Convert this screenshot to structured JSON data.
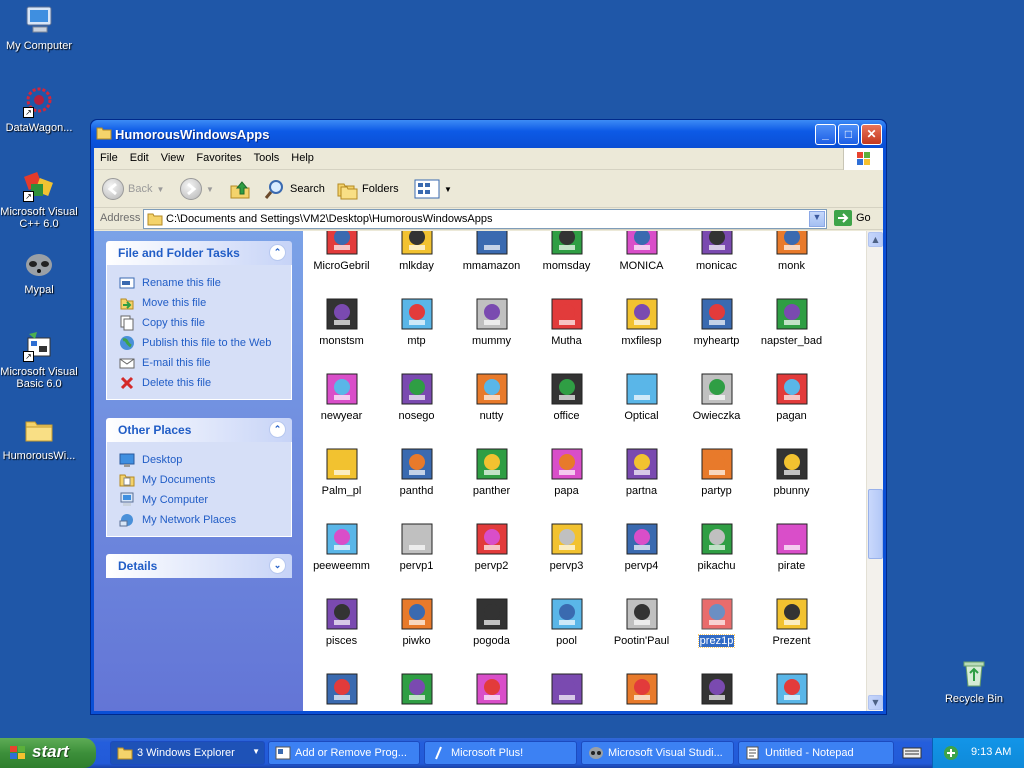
{
  "desktop": {
    "icons": [
      {
        "label": "My Computer",
        "icon": "computer-icon"
      },
      {
        "label": "DataWagon...",
        "icon": "datawagon-icon"
      },
      {
        "label": "Microsoft Visual C++ 6.0",
        "icon": "visual-cpp-icon"
      },
      {
        "label": "Mypal",
        "icon": "mypal-icon"
      },
      {
        "label": "Microsoft Visual Basic 6.0",
        "icon": "visual-basic-icon"
      },
      {
        "label": "HumorousWi...",
        "icon": "folder-icon"
      },
      {
        "label": "Recycle Bin",
        "icon": "recycle-bin-icon"
      }
    ]
  },
  "window": {
    "title": "HumorousWindowsApps",
    "menu": [
      "File",
      "Edit",
      "View",
      "Favorites",
      "Tools",
      "Help"
    ],
    "toolbar": {
      "back": "Back",
      "search": "Search",
      "folders": "Folders"
    },
    "address": {
      "label": "Address",
      "value": "C:\\Documents and Settings\\VM2\\Desktop\\HumorousWindowsApps",
      "go": "Go"
    }
  },
  "taskpane": {
    "file_tasks": {
      "title": "File and Folder Tasks",
      "items": [
        "Rename this file",
        "Move this file",
        "Copy this file",
        "Publish this file to the Web",
        "E-mail this file",
        "Delete this file"
      ]
    },
    "other_places": {
      "title": "Other Places",
      "items": [
        "Desktop",
        "My Documents",
        "My Computer",
        "My Network Places"
      ]
    },
    "details": {
      "title": "Details"
    }
  },
  "files": [
    [
      "MicroGebril",
      "mlkday",
      "mmamazon",
      "momsday",
      "MONICA",
      "monicac",
      "monk"
    ],
    [
      "monstsm",
      "mtp",
      "mummy",
      "Mutha",
      "mxfilesp",
      "myheartp",
      "napster_bad"
    ],
    [
      "newyear",
      "nosego",
      "nutty",
      "office",
      "Optical",
      "Owieczka",
      "pagan"
    ],
    [
      "Palm_pl",
      "panthd",
      "panther",
      "papa",
      "partna",
      "partyp",
      "pbunny"
    ],
    [
      "peeweemm",
      "pervp1",
      "pervp2",
      "pervp3",
      "pervp4",
      "pikachu",
      "pirate"
    ],
    [
      "pisces",
      "piwko",
      "pogoda",
      "pool",
      "Pootin'Paul",
      "prez1p",
      "Prezent"
    ],
    [
      "",
      "",
      "",
      "",
      "",
      "",
      ""
    ]
  ],
  "selected_file": "prez1p",
  "taskbar": {
    "start": "start",
    "tasks": [
      "3 Windows Explorer",
      "Add or Remove Prog...",
      "Microsoft Plus!",
      "Microsoft Visual Studi...",
      "Untitled - Notepad"
    ],
    "clock": "9:13 AM"
  },
  "colors": {
    "desktop": "#1f57a8",
    "titlebar": "#0a4fd6",
    "link": "#215dc6",
    "selection": "#316ac5"
  }
}
